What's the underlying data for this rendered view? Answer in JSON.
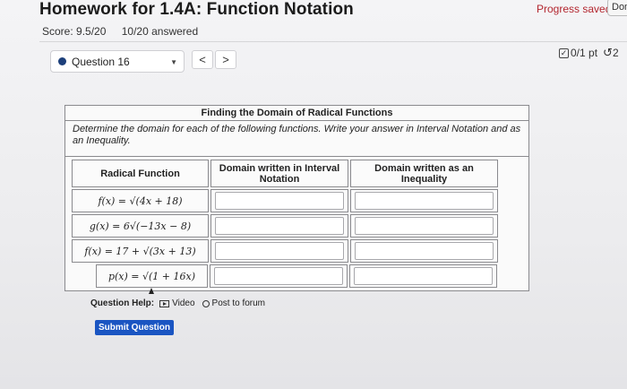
{
  "header": {
    "title": "Homework for 1.4A: Function Notation",
    "score": "Score: 9.5/20",
    "answered": "10/20 answered",
    "progress_status": "Progress saved",
    "done_label": "Done"
  },
  "question_nav": {
    "selected": "Question 16",
    "prev_label": "<",
    "next_label": ">",
    "points": "0/1 pt",
    "retries": "2"
  },
  "question": {
    "table_title": "Finding the Domain of Radical Functions",
    "instructions": "Determine the domain for each of the following functions. Write your answer in Interval Notation and as an Inequality.",
    "columns": [
      "Radical Function",
      "Domain written in Interval Notation",
      "Domain written as an Inequality"
    ],
    "rows": [
      {
        "function": "f(x) = √(4x + 18)",
        "interval_value": "",
        "inequality_value": ""
      },
      {
        "function": "g(x) = 6√(−13x − 8)",
        "interval_value": "",
        "inequality_value": ""
      },
      {
        "function": "f(x) = 17 + √(3x + 13)",
        "interval_value": "",
        "inequality_value": ""
      },
      {
        "function": "p(x) = √(1 + 16x)",
        "interval_value": "",
        "inequality_value": ""
      }
    ]
  },
  "help": {
    "label": "Question Help:",
    "video": "Video",
    "forum": "Post to forum"
  },
  "submit_label": "Submit Question",
  "colors": {
    "accent": "#1a55c2",
    "progress_text": "#b3262f",
    "question_dot": "#1c3f7a"
  }
}
